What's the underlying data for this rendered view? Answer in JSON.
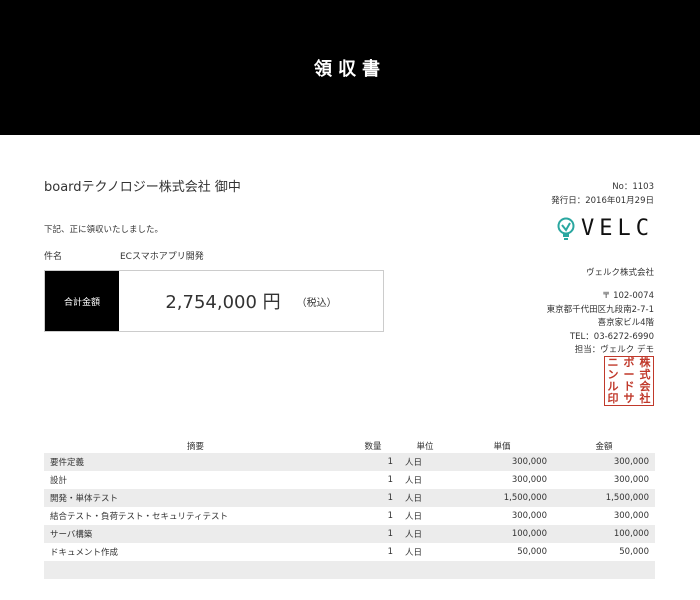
{
  "header": {
    "title": "領収書"
  },
  "client": {
    "name": "boardテクノロジー株式会社 御中"
  },
  "meta": {
    "number_label": "No：1103",
    "issue_date": "発行日：2016年01月29日"
  },
  "note": "下記、正に領収いたしました。",
  "subject": {
    "label": "件名",
    "value": "ECスマホアプリ開発"
  },
  "total": {
    "label": "合計金額",
    "amount": "2,754,000 円",
    "tax_note": "（税込）"
  },
  "issuer": {
    "logo_text": "VELC",
    "company": "ヴェルク株式会社",
    "postal": "〒 102-0074",
    "address1": "東京都千代田区九段南2-7-1",
    "address2": "喜京家ビル4階",
    "tel": "TEL：03-6272-6990",
    "contact": "担当：ヴェルク デモ"
  },
  "stamp": {
    "chars": [
      "ニ",
      "ボ",
      "株",
      "ン",
      "ー",
      "式",
      "ル",
      "ド",
      "会",
      "印",
      "サ",
      "社"
    ]
  },
  "table": {
    "headers": {
      "desc": "摘要",
      "qty": "数量",
      "unit": "単位",
      "price": "単価",
      "amount": "金額"
    },
    "rows": [
      {
        "desc": "要件定義",
        "qty": "1",
        "unit": "人日",
        "price": "300,000",
        "amount": "300,000"
      },
      {
        "desc": "設計",
        "qty": "1",
        "unit": "人日",
        "price": "300,000",
        "amount": "300,000"
      },
      {
        "desc": "開発・単体テスト",
        "qty": "1",
        "unit": "人日",
        "price": "1,500,000",
        "amount": "1,500,000"
      },
      {
        "desc": "結合テスト・負荷テスト・セキュリティテスト",
        "qty": "1",
        "unit": "人日",
        "price": "300,000",
        "amount": "300,000"
      },
      {
        "desc": "サーバ構築",
        "qty": "1",
        "unit": "人日",
        "price": "100,000",
        "amount": "100,000"
      },
      {
        "desc": "ドキュメント作成",
        "qty": "1",
        "unit": "人日",
        "price": "50,000",
        "amount": "50,000"
      }
    ]
  },
  "colors": {
    "header_bg": "#000000",
    "stamp": "#c0392b",
    "row_alt": "#ececec"
  }
}
